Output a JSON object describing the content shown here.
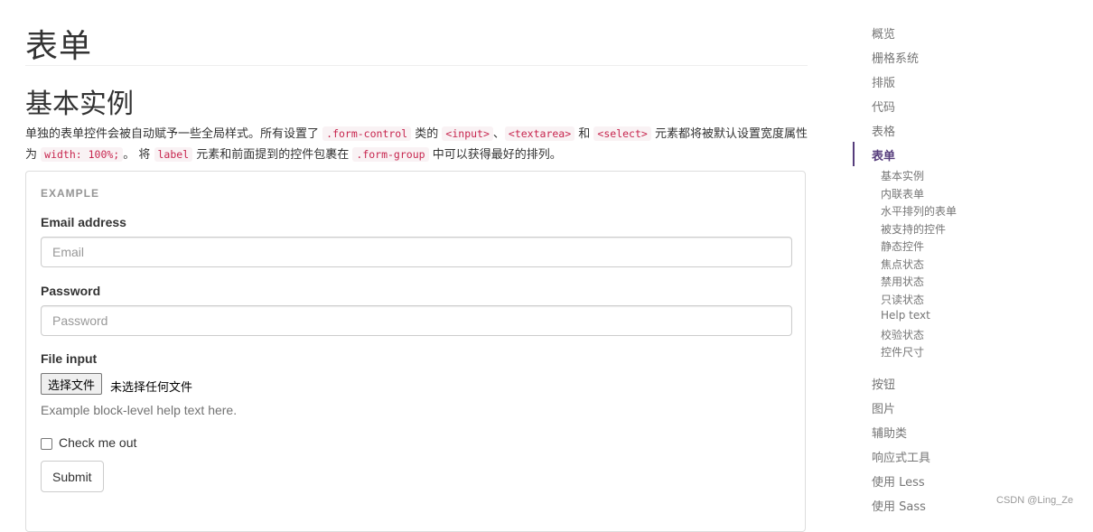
{
  "page": {
    "title": "表单",
    "section_title": "基本实例",
    "description": [
      {
        "t": "text",
        "v": "单独的表单控件会被自动赋予一些全局样式。所有设置了 "
      },
      {
        "t": "code",
        "v": ".form-control"
      },
      {
        "t": "text",
        "v": " 类的 "
      },
      {
        "t": "code",
        "v": "<input>"
      },
      {
        "t": "text",
        "v": "、"
      },
      {
        "t": "code",
        "v": "<textarea>"
      },
      {
        "t": "text",
        "v": " 和 "
      },
      {
        "t": "code",
        "v": "<select>"
      },
      {
        "t": "text",
        "v": " 元素都将被默认设置宽度属性为 "
      },
      {
        "t": "code",
        "v": "width: 100%;"
      },
      {
        "t": "text",
        "v": "。 将 "
      },
      {
        "t": "code",
        "v": "label"
      },
      {
        "t": "text",
        "v": " 元素和前面提到的控件包裹在 "
      },
      {
        "t": "code",
        "v": ".form-group"
      },
      {
        "t": "text",
        "v": " 中可以获得最好的排列。"
      }
    ]
  },
  "example": {
    "label": "EXAMPLE",
    "email_label": "Email address",
    "email_placeholder": "Email",
    "password_label": "Password",
    "password_placeholder": "Password",
    "file_label": "File input",
    "file_button": "选择文件",
    "file_status": "未选择任何文件",
    "help_text": "Example block-level help text here.",
    "checkbox_label": "Check me out",
    "submit_label": "Submit"
  },
  "sidebar": {
    "items": [
      "概览",
      "栅格系统",
      "排版",
      "代码",
      "表格",
      "表单",
      "按钮",
      "图片",
      "辅助类",
      "响应式工具",
      "使用 Less",
      "使用 Sass"
    ],
    "active": "表单",
    "sub_items": [
      "基本实例",
      "内联表单",
      "水平排列的表单",
      "被支持的控件",
      "静态控件",
      "焦点状态",
      "禁用状态",
      "只读状态",
      "Help text",
      "校验状态",
      "控件尺寸"
    ]
  },
  "watermark": "CSDN @Ling_Ze",
  "colors": {
    "accent": "#563d7c",
    "code_text": "#c7254e",
    "code_bg": "#f9f2f4",
    "muted": "#767676"
  }
}
